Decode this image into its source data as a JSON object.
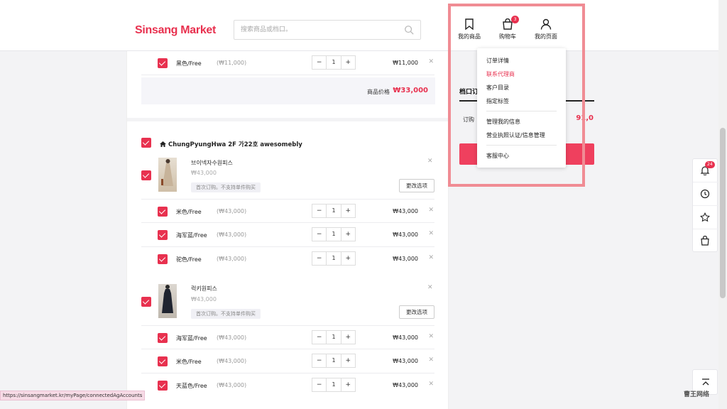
{
  "header": {
    "logo_text": "Sinsang Market",
    "search_placeholder": "搜索商品或档口。",
    "nav": {
      "my_products": "我的商品",
      "cart": "购物车",
      "cart_count": "3",
      "my_page": "我的页面"
    }
  },
  "dropdown": {
    "items": [
      "订单详情",
      "联系代理商",
      "客户目录",
      "指定标签",
      "管理我的信息",
      "营业执照认证/信息管理",
      "客服中心"
    ]
  },
  "cart": {
    "top_option": {
      "name": "黑色/Free",
      "unit_price": "(₩11,000)",
      "qty": "1",
      "price": "₩11,000"
    },
    "subtotal_label": "商品价格",
    "subtotal_value": "₩33,000",
    "store_name": "ChungPyungHwa 2F 가22호 awesomebly",
    "products": [
      {
        "title": "브이넥자수원피스",
        "price": "₩43,000",
        "tag": "首次订购。不支持单件购买",
        "change_label": "更改选项",
        "options": [
          {
            "name": "米色/Free",
            "unit_price": "(₩43,000)",
            "qty": "1",
            "price": "₩43,000"
          },
          {
            "name": "海军蓝/Free",
            "unit_price": "(₩43,000)",
            "qty": "1",
            "price": "₩43,000"
          },
          {
            "name": "驼色/Free",
            "unit_price": "(₩43,000)",
            "qty": "1",
            "price": "₩43,000"
          }
        ]
      },
      {
        "title": "럭키원피스",
        "price": "₩43,000",
        "tag": "首次订购。不支持单件购买",
        "change_label": "更改选项",
        "options": [
          {
            "name": "海军蓝/Free",
            "unit_price": "(₩43,000)",
            "qty": "1",
            "price": "₩43,000"
          },
          {
            "name": "米色/Free",
            "unit_price": "(₩43,000)",
            "qty": "1",
            "price": "₩43,000"
          },
          {
            "name": "天蓝色/Free",
            "unit_price": "(₩43,000)",
            "qty": "1",
            "price": "₩43,000"
          }
        ]
      }
    ]
  },
  "summary": {
    "title": "档口订",
    "label": "订购",
    "value": "91,0"
  },
  "float": {
    "notif_count": "24"
  },
  "status_url": "https://sinsangmarket.kr/myPage/connectedAgAccounts",
  "watermark": "曹王网络",
  "colors": {
    "accent": "#e8314f",
    "highlight": "#f08c94"
  }
}
